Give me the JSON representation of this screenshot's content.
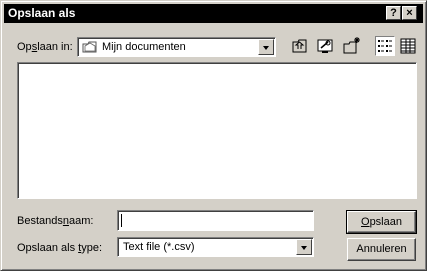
{
  "window": {
    "title": "Opslaan als",
    "help_label": "?",
    "close_label": "×"
  },
  "location": {
    "label_pre": "Op",
    "label_accel": "s",
    "label_post": "laan in:",
    "value": "Mijn documenten",
    "icon": "my-documents-folder-icon"
  },
  "toolbar": {
    "up_icon": "up-one-level-icon",
    "desktop_icon": "desktop-icon",
    "new_folder_icon": "new-folder-icon",
    "list_view_icon": "list-view-icon",
    "details_view_icon": "details-view-icon"
  },
  "filename": {
    "label_pre": "Bestands",
    "label_accel": "n",
    "label_post": "aam:",
    "value": ""
  },
  "filetype": {
    "label_pre": "Opslaan als ",
    "label_accel": "t",
    "label_post": "ype:",
    "value": "Text file (*.csv)"
  },
  "buttons": {
    "save_accel": "O",
    "save_rest": "pslaan",
    "cancel": "Annuleren"
  }
}
